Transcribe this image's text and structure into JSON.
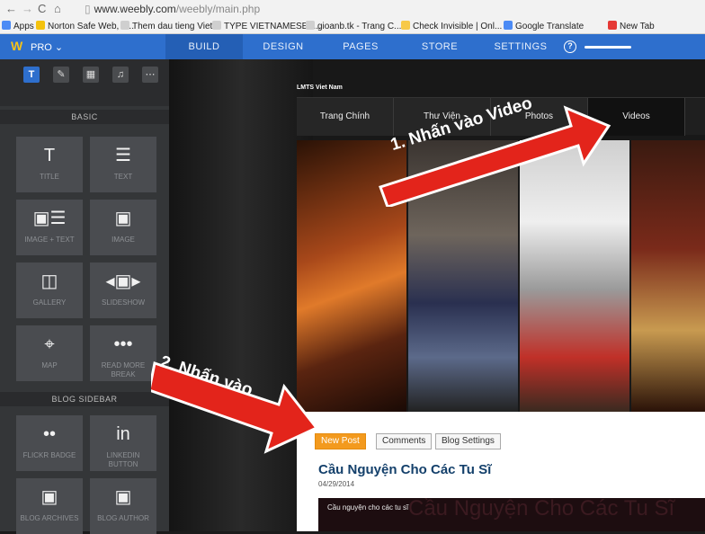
{
  "browser": {
    "url_host": "www.weebly.com",
    "url_path": "/weebly/main.php",
    "bookmarks": [
      {
        "label": "Apps",
        "color": "#4c8bf5"
      },
      {
        "label": "Norton Safe Web, fr...",
        "color": "#f4c20d"
      },
      {
        "label": "Them dau tieng Viet",
        "color": "#cfcfcf"
      },
      {
        "label": "TYPE VIETNAMESE -...",
        "color": "#cfcfcf"
      },
      {
        "label": "gioanb.tk - Trang C...",
        "color": "#cfcfcf"
      },
      {
        "label": "Check Invisible | Onl...",
        "color": "#f7c948"
      },
      {
        "label": "Google Translate",
        "color": "#4c8bf5"
      },
      {
        "label": "New Tab",
        "color": "#e53935"
      }
    ]
  },
  "weebly": {
    "logo": "W",
    "plan": "PRO ⌄",
    "tabs": [
      "BUILD",
      "DESIGN",
      "PAGES",
      "STORE",
      "SETTINGS"
    ],
    "active_tab": "BUILD",
    "help": "?"
  },
  "sidebar": {
    "tools": [
      "T",
      "✎",
      "▦",
      "♫",
      "⋯"
    ],
    "basic_header": "BASIC",
    "basic": [
      {
        "label": "TITLE",
        "glyph": "T"
      },
      {
        "label": "TEXT",
        "glyph": "☰"
      },
      {
        "label": "IMAGE + TEXT",
        "glyph": "▣☰"
      },
      {
        "label": "IMAGE",
        "glyph": "▣"
      },
      {
        "label": "GALLERY",
        "glyph": "◫"
      },
      {
        "label": "SLIDESHOW",
        "glyph": "◂▣▸"
      },
      {
        "label": "MAP",
        "glyph": "⌖"
      },
      {
        "label": "READ MORE BREAK",
        "glyph": "•••"
      }
    ],
    "blog_header": "BLOG SIDEBAR",
    "blog": [
      {
        "label": "FLICKR BADGE",
        "glyph": "••"
      },
      {
        "label": "LINKEDIN BUTTON",
        "glyph": "in"
      },
      {
        "label": "BLOG ARCHIVES",
        "glyph": "▣"
      },
      {
        "label": "BLOG AUTHOR",
        "glyph": "▣"
      }
    ]
  },
  "site": {
    "name": "LMTS Viet Nam",
    "nav": [
      "Trang Chính",
      "Thư Viện",
      "Photos",
      "Videos"
    ],
    "post_buttons": [
      "New Post",
      "Comments",
      "Blog Settings"
    ],
    "post_title": "Cầu Nguyện Cho Các Tu Sĩ",
    "post_date": "04/29/2014",
    "video_label": "Cầu nguyện cho các tu sĩ",
    "video_overlay": "Cầu Nguyện Cho Các Tu Sĩ"
  },
  "annotations": {
    "arrow1": "1. Nhấn vào Video",
    "arrow2": "2. Nhấn vào",
    "arrow_color": "#e3241b"
  }
}
